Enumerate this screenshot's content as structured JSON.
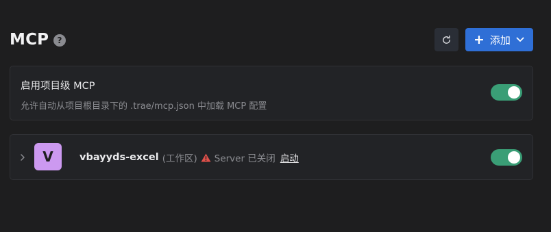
{
  "header": {
    "title": "MCP",
    "help_icon": "question-circle-icon",
    "refresh_icon": "refresh-icon",
    "add_label": "添加",
    "add_icon": "plus-icon",
    "add_dropdown_icon": "chevron-down-icon",
    "accent_color": "#2f6fd6"
  },
  "project_setting": {
    "title": "启用项目级 MCP",
    "description": "允许自动从项目根目录下的 .trae/mcp.json 中加载 MCP 配置",
    "enabled": true
  },
  "servers": [
    {
      "avatar_letter": "V",
      "avatar_color": "#cc99f0",
      "name": "vbayyds-excel",
      "scope": "(工作区)",
      "status_icon": "warning-triangle-icon",
      "status_color": "#e0504a",
      "status": "Server 已关闭",
      "action": "启动",
      "enabled": true
    }
  ],
  "toggle_on_color": "#3a9e76"
}
